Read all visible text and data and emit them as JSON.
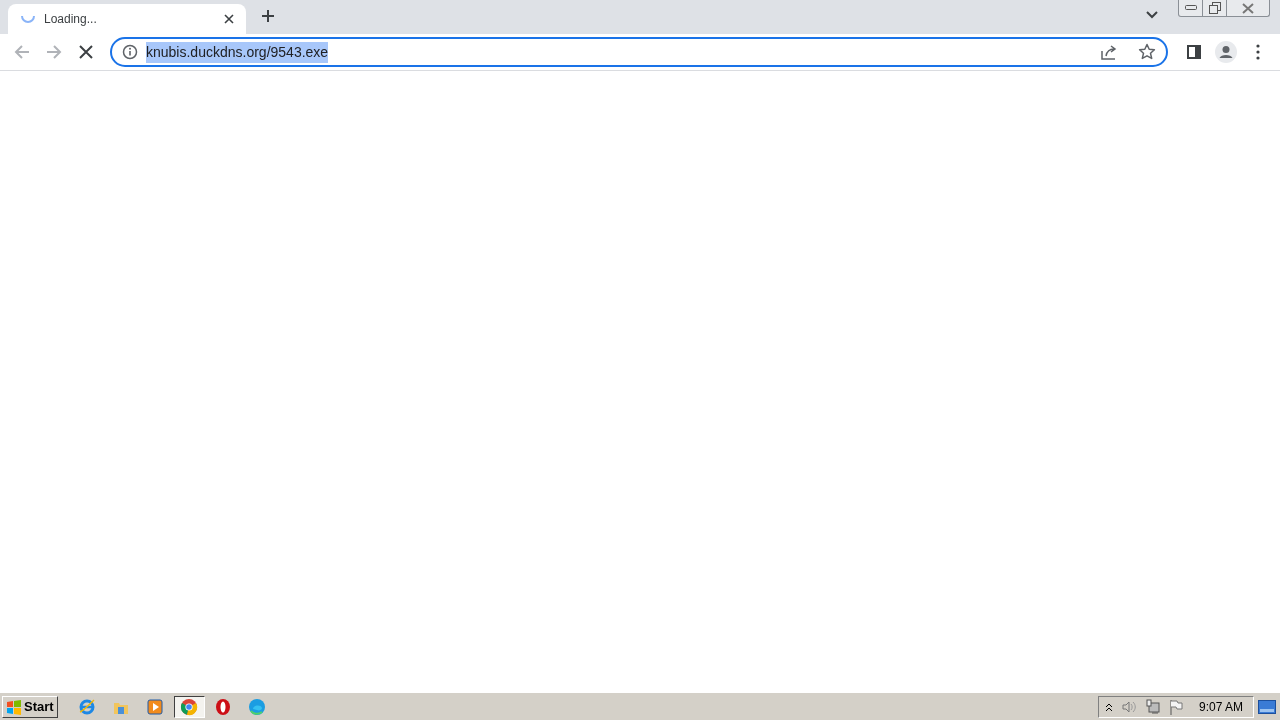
{
  "tabs": [
    {
      "title": "Loading...",
      "loading": true,
      "selected": true
    }
  ],
  "address_bar": {
    "url": "knubis.duckdns.org/9543.exe",
    "url_selected": true,
    "focused": true
  },
  "page_loading": true,
  "taskbar": {
    "start_label": "Start",
    "apps": [
      {
        "kind": "ie",
        "selected": false
      },
      {
        "kind": "folder",
        "selected": false
      },
      {
        "kind": "media",
        "selected": false
      },
      {
        "kind": "chrome",
        "selected": true
      },
      {
        "kind": "opera",
        "selected": false
      },
      {
        "kind": "edge",
        "selected": false
      }
    ],
    "clock": "9:07 AM"
  }
}
